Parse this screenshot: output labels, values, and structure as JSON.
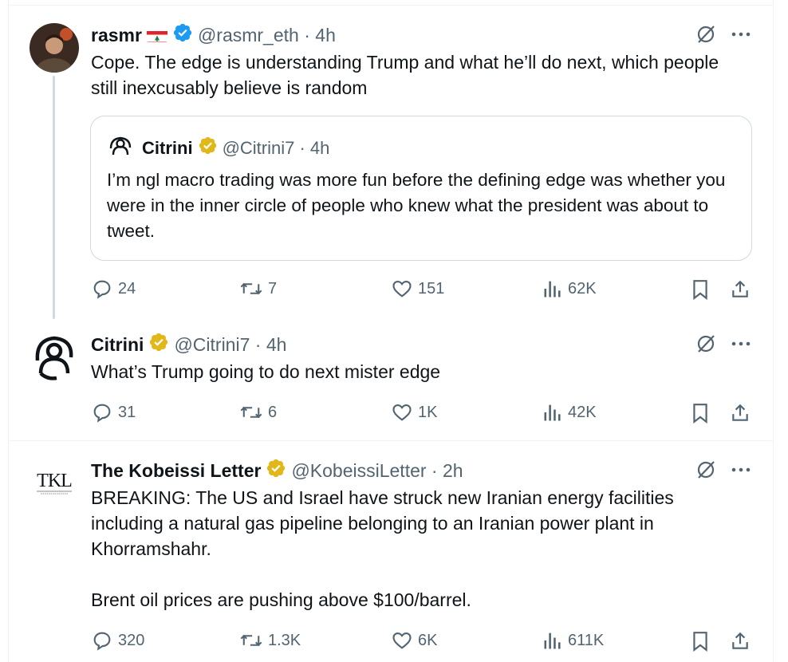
{
  "tweets": [
    {
      "name": "rasmr",
      "handle": "@rasmr_eth",
      "time": "4h",
      "text": "Cope. The edge is understanding Trump and what he’ll do next, which people still inexcusably believe is random",
      "quote": {
        "name": "Citrini",
        "handle": "@Citrini7",
        "time": "4h",
        "text": "I’m ngl macro trading was more fun before the defining edge was whether you were in the inner circle of people who knew what the president was about to tweet."
      },
      "replies": "24",
      "reposts": "7",
      "likes": "151",
      "views": "62K"
    },
    {
      "name": "Citrini",
      "handle": "@Citrini7",
      "time": "4h",
      "text": "What’s Trump going to do next mister edge",
      "replies": "31",
      "reposts": "6",
      "likes": "1K",
      "views": "42K"
    },
    {
      "name": "The Kobeissi Letter",
      "handle": "@KobeissiLetter",
      "time": "2h",
      "avatar_text": "TKL",
      "text": "BREAKING: The US and Israel have struck new Iranian energy facilities including a natural gas pipeline belonging to an Iranian power plant in Khorramshahr.\n\nBrent oil prices are pushing above $100/barrel.",
      "replies": "320",
      "reposts": "1.3K",
      "likes": "6K",
      "views": "611K"
    }
  ],
  "colors": {
    "verified_blue": "#1d9bf0",
    "verified_gold": "#e2b719",
    "text": "#0f1419",
    "secondary": "#536471",
    "border": "#cfd9de"
  },
  "icons": [
    "reply-icon",
    "repost-icon",
    "like-icon",
    "views-icon",
    "bookmark-icon",
    "share-icon",
    "grok-icon",
    "more-icon"
  ]
}
